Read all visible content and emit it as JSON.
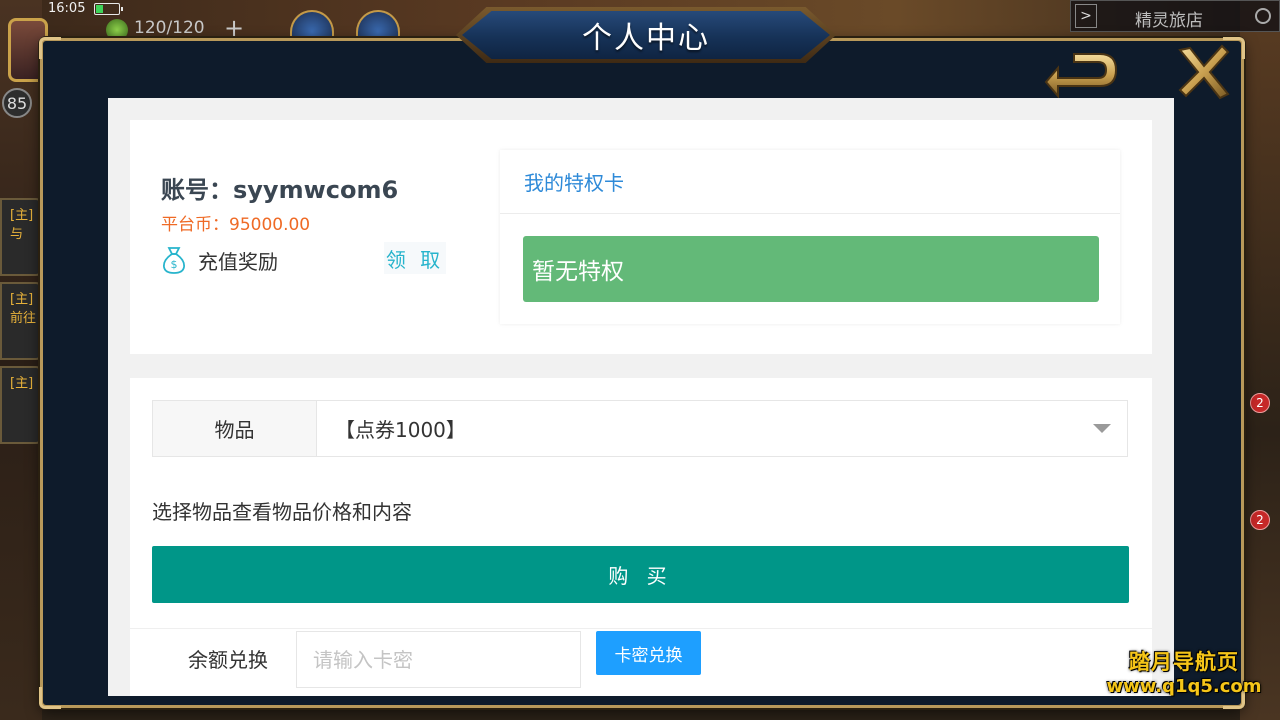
{
  "status_bar": {
    "time": "16:05",
    "battery_percent": 30
  },
  "hud": {
    "stamina": "120/120",
    "level": "85",
    "location_name": "精灵旅店",
    "quest_tabs": [
      "[主]与",
      "[主]前往",
      "[主]"
    ],
    "notification_count": "2"
  },
  "modal": {
    "title": "个人中心",
    "back_icon": "back-arrow-icon",
    "close_icon": "close-x-icon"
  },
  "account": {
    "account_label": "账号：",
    "account_name": "syymwcom6",
    "coin_label": "平台币：",
    "coin_value": "95000.00",
    "recharge_reward_label": "充值奖励",
    "claim_label": "领 取"
  },
  "privilege": {
    "header": "我的特权卡",
    "empty_text": "暂无特权"
  },
  "shop": {
    "item_label": "物品",
    "item_selected": "【点券1000】",
    "hint": "选择物品查看物品价格和内容",
    "buy_label": "购 买"
  },
  "redeem": {
    "label": "余额兑换",
    "placeholder": "请输入卡密",
    "button_label": "卡密兑换"
  },
  "watermark": {
    "line1": "踏月导航页",
    "line2": "www.q1q5.com"
  },
  "colors": {
    "buy_button": "#009688",
    "redeem_button": "#1e9fff",
    "no_privilege": "#63b978",
    "coin_text": "#ef6a25",
    "privilege_header": "#2e8ad8",
    "claim_text": "#27b4cc"
  }
}
